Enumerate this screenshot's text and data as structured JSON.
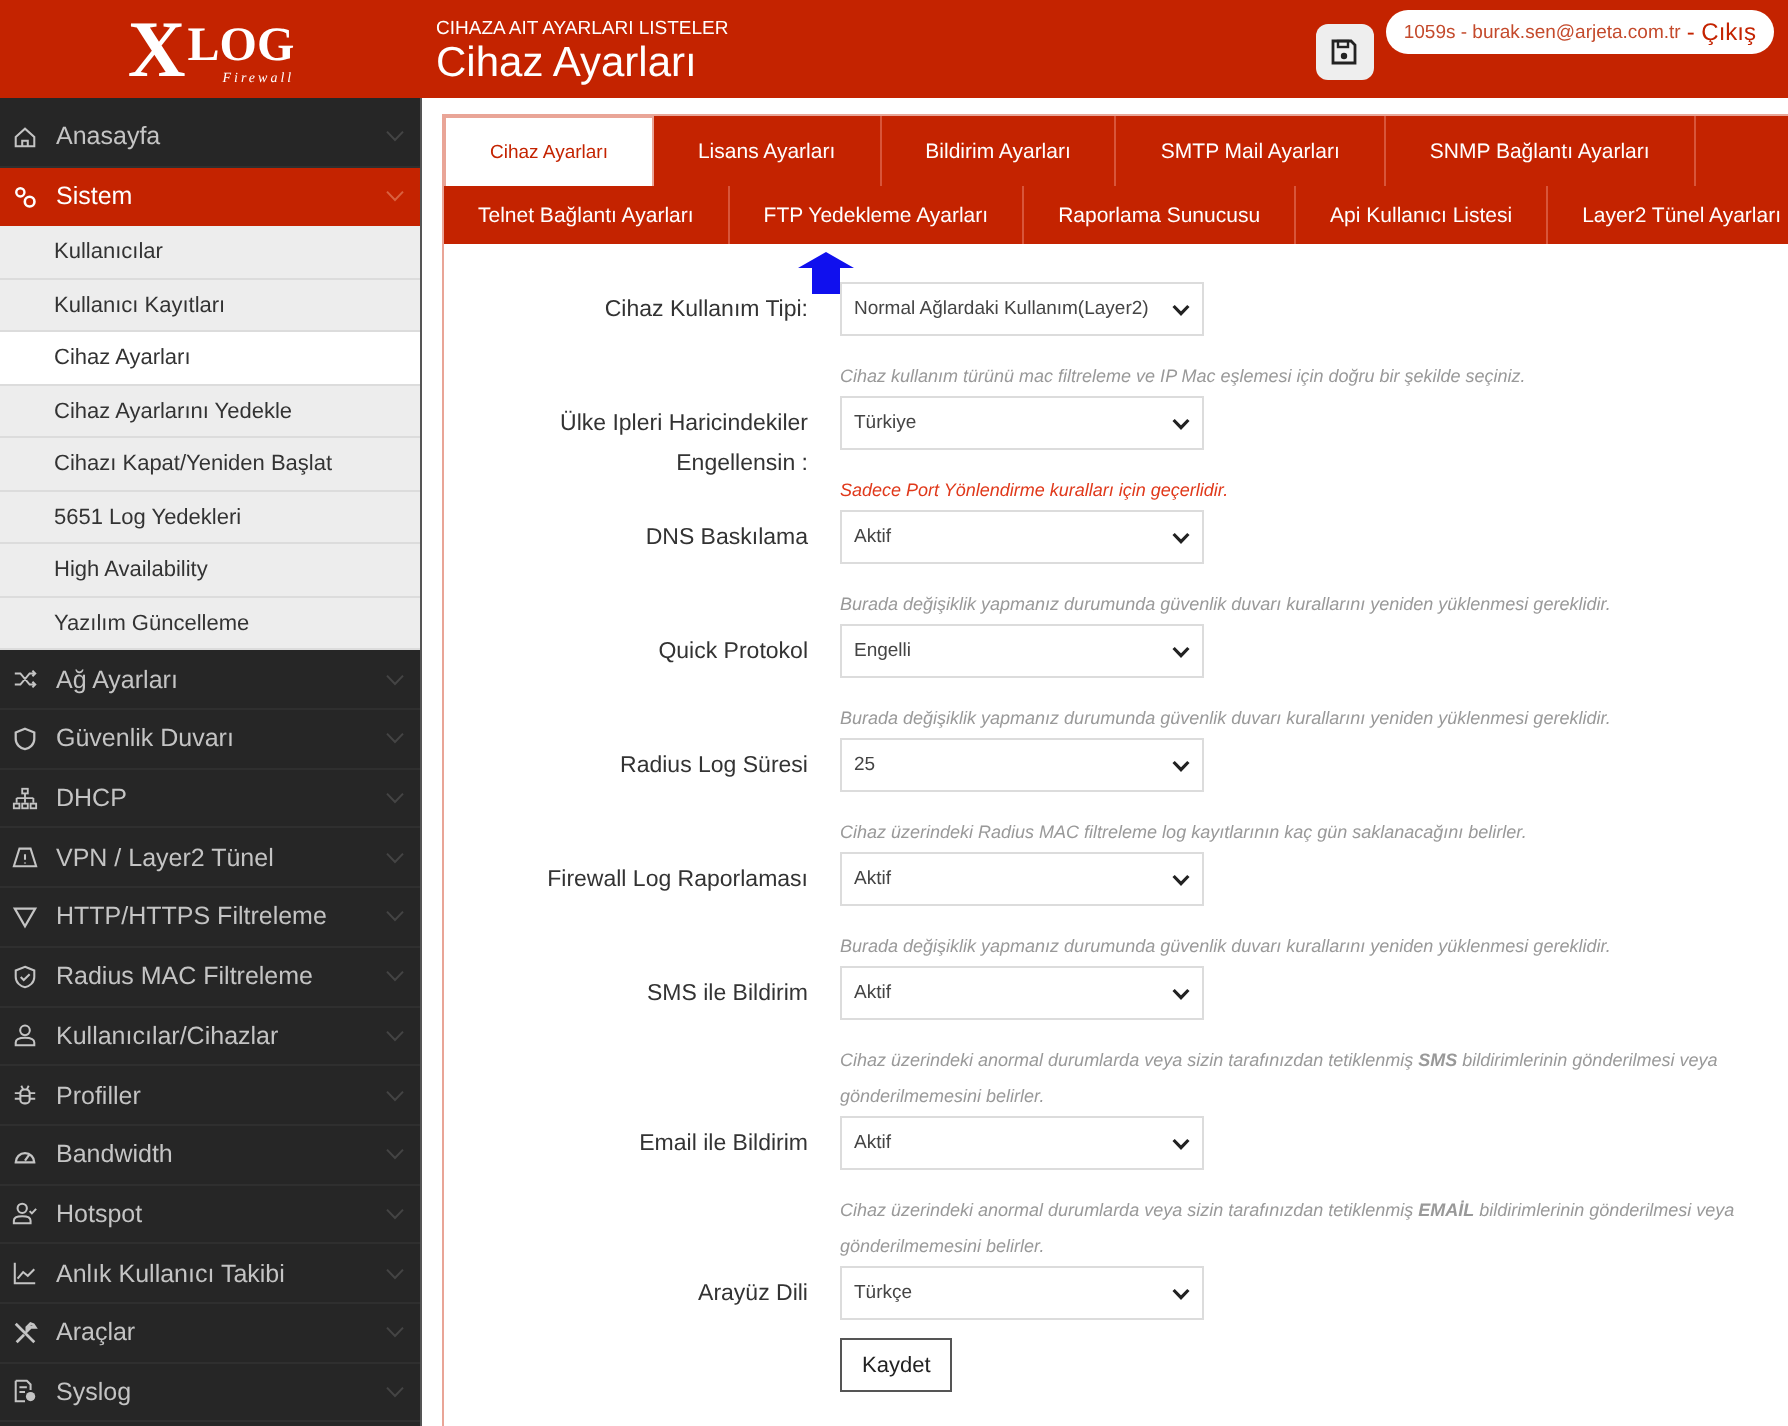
{
  "logo": {
    "mark": "X",
    "text": "LOG",
    "subtitle": "Firewall"
  },
  "header": {
    "subtitle": "CIHAZA AIT AYARLARI LISTELER",
    "title": "Cihaz Ayarları",
    "session": "1059s - burak.sen@arjeta.com.tr",
    "logout": "- Çıkış"
  },
  "sidebar": {
    "items": [
      {
        "label": "Anasayfa",
        "selected": false,
        "expanded": false
      },
      {
        "label": "Sistem",
        "selected": true,
        "expanded": true,
        "children": [
          {
            "label": "Kullanıcılar",
            "selected": false
          },
          {
            "label": "Kullanıcı Kayıtları",
            "selected": false
          },
          {
            "label": "Cihaz Ayarları",
            "selected": true
          },
          {
            "label": "Cihaz Ayarlarını Yedekle",
            "selected": false
          },
          {
            "label": "Cihazı Kapat/Yeniden Başlat",
            "selected": false
          },
          {
            "label": "5651 Log Yedekleri",
            "selected": false
          },
          {
            "label": "High Availability",
            "selected": false
          },
          {
            "label": "Yazılım Güncelleme",
            "selected": false
          }
        ]
      },
      {
        "label": "Ağ Ayarları",
        "selected": false,
        "expanded": false
      },
      {
        "label": "Güvenlik Duvarı",
        "selected": false,
        "expanded": false
      },
      {
        "label": "DHCP",
        "selected": false,
        "expanded": false
      },
      {
        "label": "VPN / Layer2 Tünel",
        "selected": false,
        "expanded": false
      },
      {
        "label": "HTTP/HTTPS Filtreleme",
        "selected": false,
        "expanded": false
      },
      {
        "label": "Radius MAC Filtreleme",
        "selected": false,
        "expanded": false
      },
      {
        "label": "Kullanıcılar/Cihazlar",
        "selected": false,
        "expanded": false
      },
      {
        "label": "Profiller",
        "selected": false,
        "expanded": false
      },
      {
        "label": "Bandwidth",
        "selected": false,
        "expanded": false
      },
      {
        "label": "Hotspot",
        "selected": false,
        "expanded": false
      },
      {
        "label": "Anlık Kullanıcı Takibi",
        "selected": false,
        "expanded": false
      },
      {
        "label": "Araçlar",
        "selected": false,
        "expanded": false
      },
      {
        "label": "Syslog",
        "selected": false,
        "expanded": false
      }
    ]
  },
  "tab_rows": [
    [
      {
        "label": "Cihaz Ayarları",
        "selected": true
      },
      {
        "label": "Lisans Ayarları",
        "selected": false
      },
      {
        "label": "Bildirim Ayarları",
        "selected": false
      },
      {
        "label": "SMTP Mail Ayarları",
        "selected": false
      },
      {
        "label": "SNMP Bağlantı Ayarları",
        "selected": false
      }
    ],
    [
      {
        "label": "Telnet Bağlantı Ayarları",
        "selected": false
      },
      {
        "label": "FTP Yedekleme Ayarları",
        "selected": false
      },
      {
        "label": "Raporlama Sunucusu",
        "selected": false
      },
      {
        "label": "Api Kullanıcı Listesi",
        "selected": false
      },
      {
        "label": "Layer2 Tünel Ayarları",
        "selected": false
      }
    ]
  ],
  "form": {
    "fields": [
      {
        "label": "Cihaz Kullanım Tipi:",
        "value": "Normal Ağlardaki Kullanım(Layer2)",
        "note": {
          "text": "Cihaz kullanım türünü mac filtreleme ve IP Mac eşlemesi için doğru bir şekilde seçiniz.",
          "kind": "info"
        }
      },
      {
        "label": "Ülke Ipleri Haricindekiler Engellensin :",
        "value": "Türkiye",
        "note": {
          "text": "Sadece Port Yönlendirme kuralları için geçerlidir.",
          "kind": "warning"
        }
      },
      {
        "label": "DNS Baskılama",
        "value": "Aktif",
        "note": {
          "text": "Burada değişiklik yapmanız durumunda güvenlik duvarı kurallarını yeniden yüklenmesi gereklidir.",
          "kind": "info"
        }
      },
      {
        "label": "Quick Protokol",
        "value": "Engelli",
        "note": {
          "text": "Burada değişiklik yapmanız durumunda güvenlik duvarı kurallarını yeniden yüklenmesi gereklidir.",
          "kind": "info"
        }
      },
      {
        "label": "Radius Log Süresi",
        "value": "25",
        "note": {
          "text": "Cihaz üzerindeki Radius MAC filtreleme log kayıtlarının kaç gün saklanacağını belirler.",
          "kind": "info"
        }
      },
      {
        "label": "Firewall Log Raporlaması",
        "value": "Aktif",
        "note": {
          "text": "Burada değişiklik yapmanız durumunda güvenlik duvarı kurallarını yeniden yüklenmesi gereklidir.",
          "kind": "info"
        }
      },
      {
        "label": "SMS ile Bildirim",
        "value": "Aktif",
        "note": {
          "text": "Cihaz üzerindeki anormal durumlarda veya sizin tarafınızdan tetiklenmiş **SMS** bildirimlerinin gönderilmesi veya gönderilmemesini belirler.",
          "kind": "info"
        }
      },
      {
        "label": "Email ile Bildirim",
        "value": "Aktif",
        "note": {
          "text": "Cihaz üzerindeki anormal durumlarda veya sizin tarafınızdan tetiklenmiş **EMAİL** bildirimlerinin gönderilmesi veya gönderilmemesini belirler.",
          "kind": "info"
        }
      },
      {
        "label": "Arayüz Dili",
        "value": "Türkçe"
      }
    ],
    "save_button": "Kaydet"
  }
}
